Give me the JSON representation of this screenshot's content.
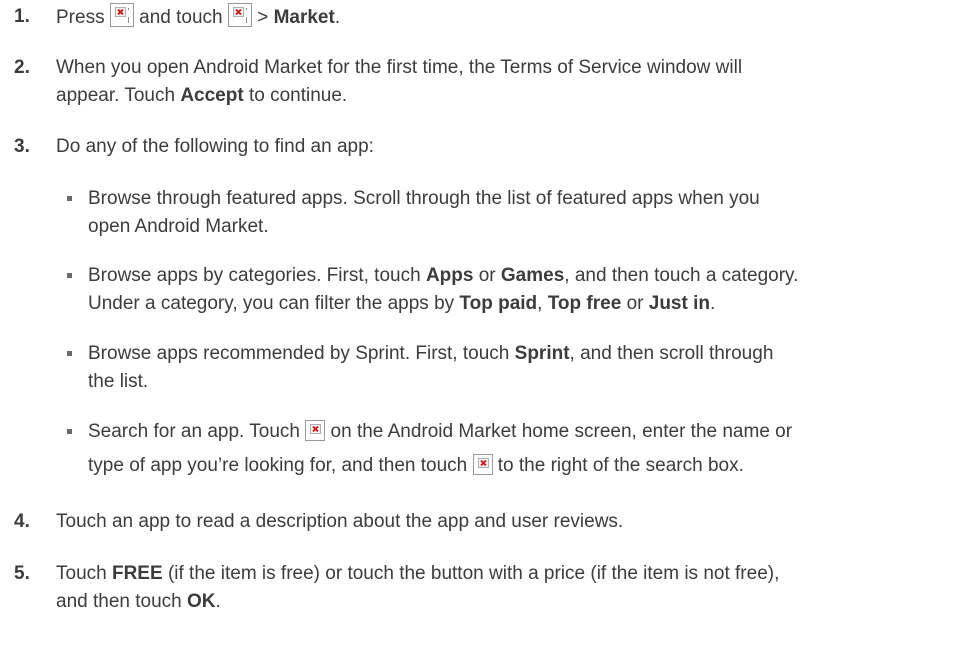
{
  "steps": [
    {
      "number": "1.",
      "press": "Press",
      "and_touch": "and touch",
      "gt": ">",
      "market": "Market",
      "period": "."
    },
    {
      "number": "2.",
      "line1": "When you open Android Market for the first time, the Terms of Service window will",
      "line2_pre": "appear. Touch",
      "accept": "Accept",
      "line2_post": "to continue."
    },
    {
      "number": "3.",
      "text": "Do any of the following to find an app:"
    },
    {
      "number": "4.",
      "text": "Touch an app to read a description about the app and user reviews."
    },
    {
      "number": "5.",
      "touch": "Touch",
      "free": "FREE",
      "line1_post": "(if the item is free) or touch the button with a price (if the item is not free),",
      "line2_pre": "and then touch",
      "ok": "OK",
      "period": "."
    }
  ],
  "bullets": [
    {
      "line1": "Browse through featured apps. Scroll through the list of featured apps when you",
      "line2": "open Android Market."
    },
    {
      "line1_pre": "Browse apps by categories. First, touch",
      "apps": "Apps",
      "or": "or",
      "games": "Games",
      "line1_post": ", and then touch a category.",
      "line2_pre": "Under a category, you can filter the apps by",
      "top_paid": "Top paid",
      "comma": ",",
      "top_free": "Top free",
      "or2": "or",
      "just_in": "Just in",
      "period": "."
    },
    {
      "line1_pre": "Browse apps recommended by Sprint. First, touch",
      "sprint": "Sprint",
      "line1_post": ", and then scroll through",
      "line2": "the list."
    },
    {
      "line1_pre": "Search for an app. Touch",
      "line1_post": "on the Android Market home screen, enter the name or",
      "line2_pre": "type of app you’re looking for, and then touch",
      "line2_post": "to the right of the search box."
    }
  ],
  "icons": {
    "home_key": "broken-image-icon",
    "menu_key": "broken-image-icon",
    "search_key": "broken-image-icon",
    "search_button": "broken-image-icon"
  }
}
